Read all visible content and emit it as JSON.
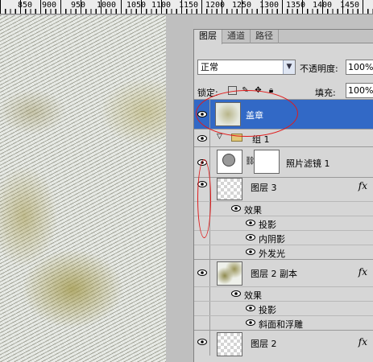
{
  "ruler": {
    "labels": [
      "850",
      "900",
      "950",
      "1000",
      "1050",
      "1100",
      "1150",
      "1200",
      "1250",
      "1300",
      "1350",
      "1400",
      "1450"
    ]
  },
  "panel": {
    "tabs": [
      "图层",
      "通道",
      "路径"
    ],
    "blend_mode": "正常",
    "opacity_label": "不透明度:",
    "opacity_value": "100%",
    "lock_label": "锁定:",
    "fill_label": "填充:",
    "fill_value": "100%"
  },
  "layers": {
    "stamp": {
      "name": "盖章"
    },
    "group1": {
      "name": "组 1"
    },
    "photo_filter": {
      "name": "照片滤镜 1"
    },
    "layer3": {
      "name": "图层 3",
      "fx": "fx",
      "effects_label": "效果",
      "effects": [
        "投影",
        "内阴影",
        "外发光"
      ]
    },
    "layer2_copy": {
      "name": "图层 2 副本",
      "fx": "fx",
      "effects_label": "效果",
      "effects": [
        "投影",
        "斜面和浮雕"
      ]
    },
    "layer2": {
      "name": "图层 2",
      "fx": "fx"
    }
  },
  "colors": {
    "selection": "#3269c6",
    "annotation": "#e01b1b"
  }
}
